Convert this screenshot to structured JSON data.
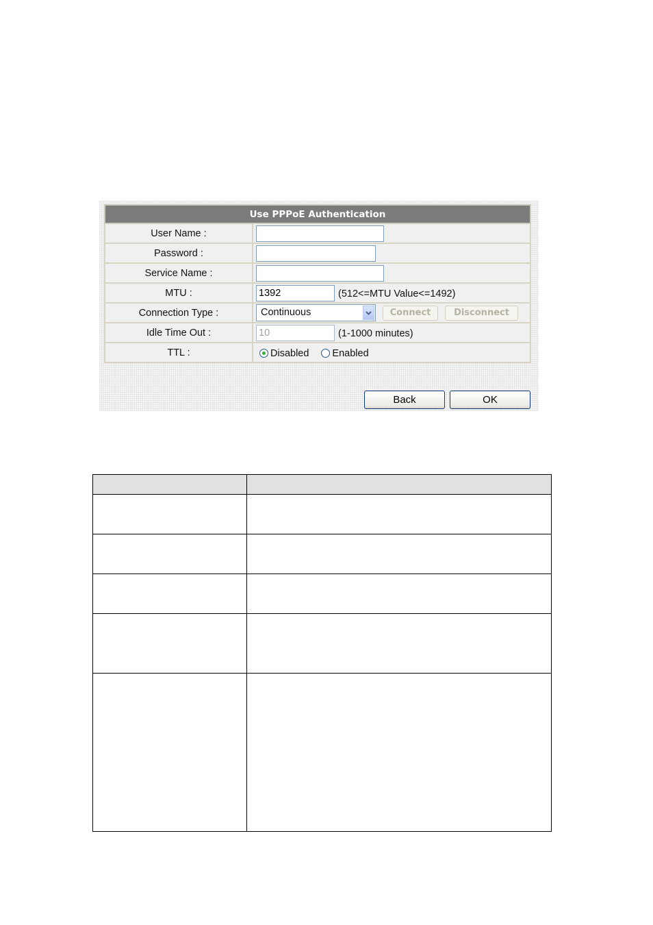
{
  "pppoe_form": {
    "title": "Use PPPoE Authentication",
    "fields": {
      "user_name": {
        "label": "User Name :",
        "value": ""
      },
      "password": {
        "label": "Password :",
        "value": ""
      },
      "service_name": {
        "label": "Service Name :",
        "value": ""
      },
      "mtu": {
        "label": "MTU :",
        "value": "1392",
        "hint": "(512<=MTU Value<=1492)"
      },
      "connection_type": {
        "label": "Connection Type :",
        "selected": "Continuous",
        "connect_label": "Connect",
        "disconnect_label": "Disconnect"
      },
      "idle_time_out": {
        "label": "Idle Time Out :",
        "value": "10",
        "hint": "(1-1000 minutes)"
      },
      "ttl": {
        "label": "TTL :",
        "options": [
          {
            "label": "Disabled",
            "selected": true
          },
          {
            "label": "Enabled",
            "selected": false
          }
        ]
      }
    },
    "buttons": {
      "back": "Back",
      "ok": "OK"
    },
    "colors": {
      "header_bg": "#7b7b7b",
      "row_bg": "#f0f0f0",
      "border": "#d8d4c4",
      "radio_on": "#2fb02f"
    }
  },
  "description_table": {
    "header": [
      "",
      ""
    ],
    "rows": [
      [
        "",
        ""
      ],
      [
        "",
        ""
      ],
      [
        "",
        ""
      ],
      [
        "",
        ""
      ],
      [
        "",
        ""
      ]
    ]
  }
}
